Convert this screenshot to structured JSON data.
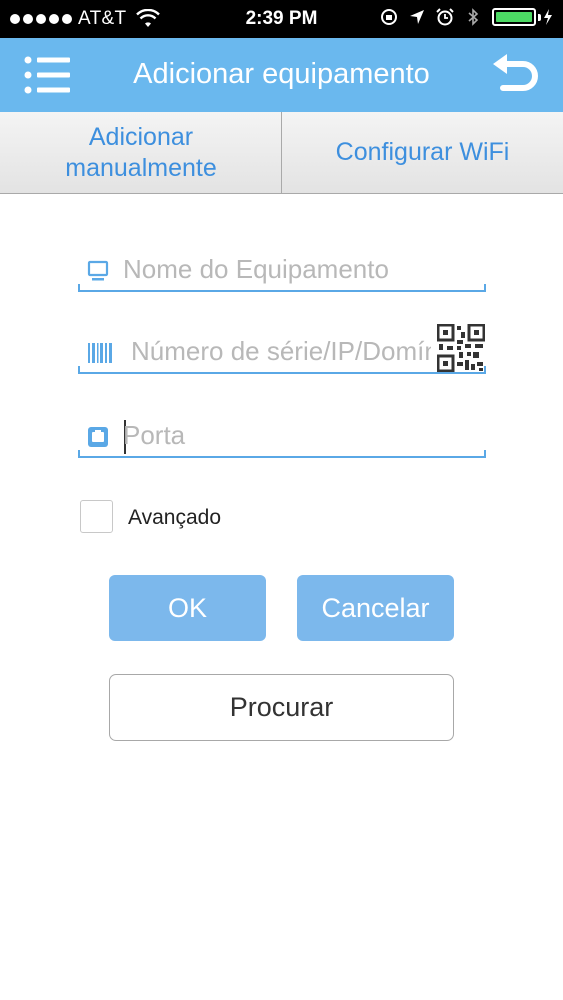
{
  "status_bar": {
    "carrier": "AT&T",
    "time": "2:39 PM"
  },
  "header": {
    "title": "Adicionar equipamento",
    "menu_icon": "list-menu-icon",
    "back_icon": "return-arrow-icon"
  },
  "tabs": {
    "manual_line1": "Adicionar",
    "manual_line2": "manualmente",
    "wifi": "Configurar WiFi"
  },
  "form": {
    "device_name_placeholder": "Nome do Equipamento",
    "serial_placeholder": "Número de série/IP/Domínio",
    "port_placeholder": "Porta",
    "advanced_label": "Avançado"
  },
  "buttons": {
    "ok": "OK",
    "cancel": "Cancelar",
    "search": "Procurar"
  },
  "colors": {
    "header_bg": "#6ab8ee",
    "accent": "#3d8fde",
    "button_bg": "#7cb8ec",
    "field_line": "#5aa8e6"
  }
}
